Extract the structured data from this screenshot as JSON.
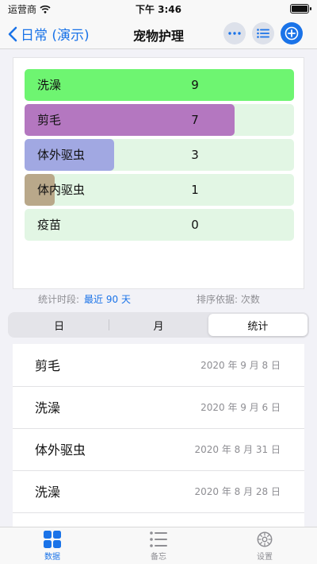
{
  "status_bar": {
    "carrier": "运营商",
    "time": "下午 3:46"
  },
  "nav": {
    "back_label": "日常 (演示)",
    "title": "宠物护理"
  },
  "stats": {
    "rows": [
      {
        "label": "洗澡",
        "count": "9",
        "fraction": 1.0,
        "color": "#6ef571"
      },
      {
        "label": "剪毛",
        "count": "7",
        "fraction": 0.778,
        "color": "#b477c0"
      },
      {
        "label": "体外驱虫",
        "count": "3",
        "fraction": 0.333,
        "color": "#a1a8e2"
      },
      {
        "label": "体内驱虫",
        "count": "1",
        "fraction": 0.111,
        "color": "#b9a88a"
      },
      {
        "label": "疫苗",
        "count": "0",
        "fraction": 0.0,
        "color": "#6ef571"
      }
    ]
  },
  "meta": {
    "period_label": "统计时段:",
    "period_value": "最近 90 天",
    "sort_label": "排序依据: 次数"
  },
  "segments": [
    {
      "label": "日",
      "active": false
    },
    {
      "label": "月",
      "active": false
    },
    {
      "label": "统计",
      "active": true
    }
  ],
  "records": [
    {
      "name": "剪毛",
      "date": "2020 年 9 月 8 日"
    },
    {
      "name": "洗澡",
      "date": "2020 年 9 月 6 日"
    },
    {
      "name": "体外驱虫",
      "date": "2020 年 8 月 31 日"
    },
    {
      "name": "洗澡",
      "date": "2020 年 8 月 28 日"
    }
  ],
  "tabs": [
    {
      "label": "数据",
      "icon": "grid-icon",
      "active": true
    },
    {
      "label": "备忘",
      "icon": "list-icon",
      "active": false
    },
    {
      "label": "设置",
      "icon": "gear-icon",
      "active": false
    }
  ],
  "colors": {
    "accent": "#1a73e8",
    "bar_track": "#e2f6e4"
  }
}
